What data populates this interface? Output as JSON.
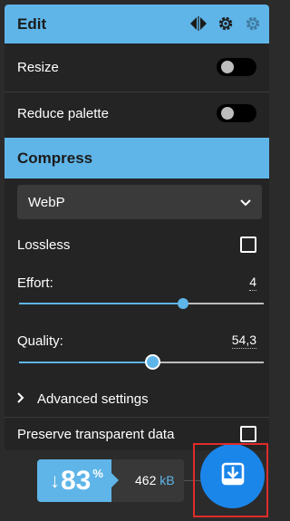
{
  "edit": {
    "title": "Edit",
    "icons": [
      "compare-icon",
      "settings-gear-icon",
      "settings-gear-dim-icon"
    ],
    "resize_label": "Resize",
    "reduce_palette_label": "Reduce palette"
  },
  "compress": {
    "title": "Compress",
    "format_selected": "WebP",
    "lossless_label": "Lossless",
    "effort_label": "Effort:",
    "effort_value": "4",
    "effort_fraction": 0.67,
    "quality_label": "Quality:",
    "quality_value": "54,3",
    "quality_fraction": 0.543,
    "advanced_label": "Advanced settings",
    "preserve_label": "Preserve transparent data"
  },
  "footer": {
    "arrow": "↓",
    "percent": "83",
    "percent_sign": "%",
    "size_value": "462",
    "size_unit": "kB"
  },
  "colors": {
    "accent": "#5fb5e8",
    "download_button": "#1b86ea",
    "panel": "#242424",
    "background": "#2b2b2b",
    "highlight": "#e02b2b"
  }
}
